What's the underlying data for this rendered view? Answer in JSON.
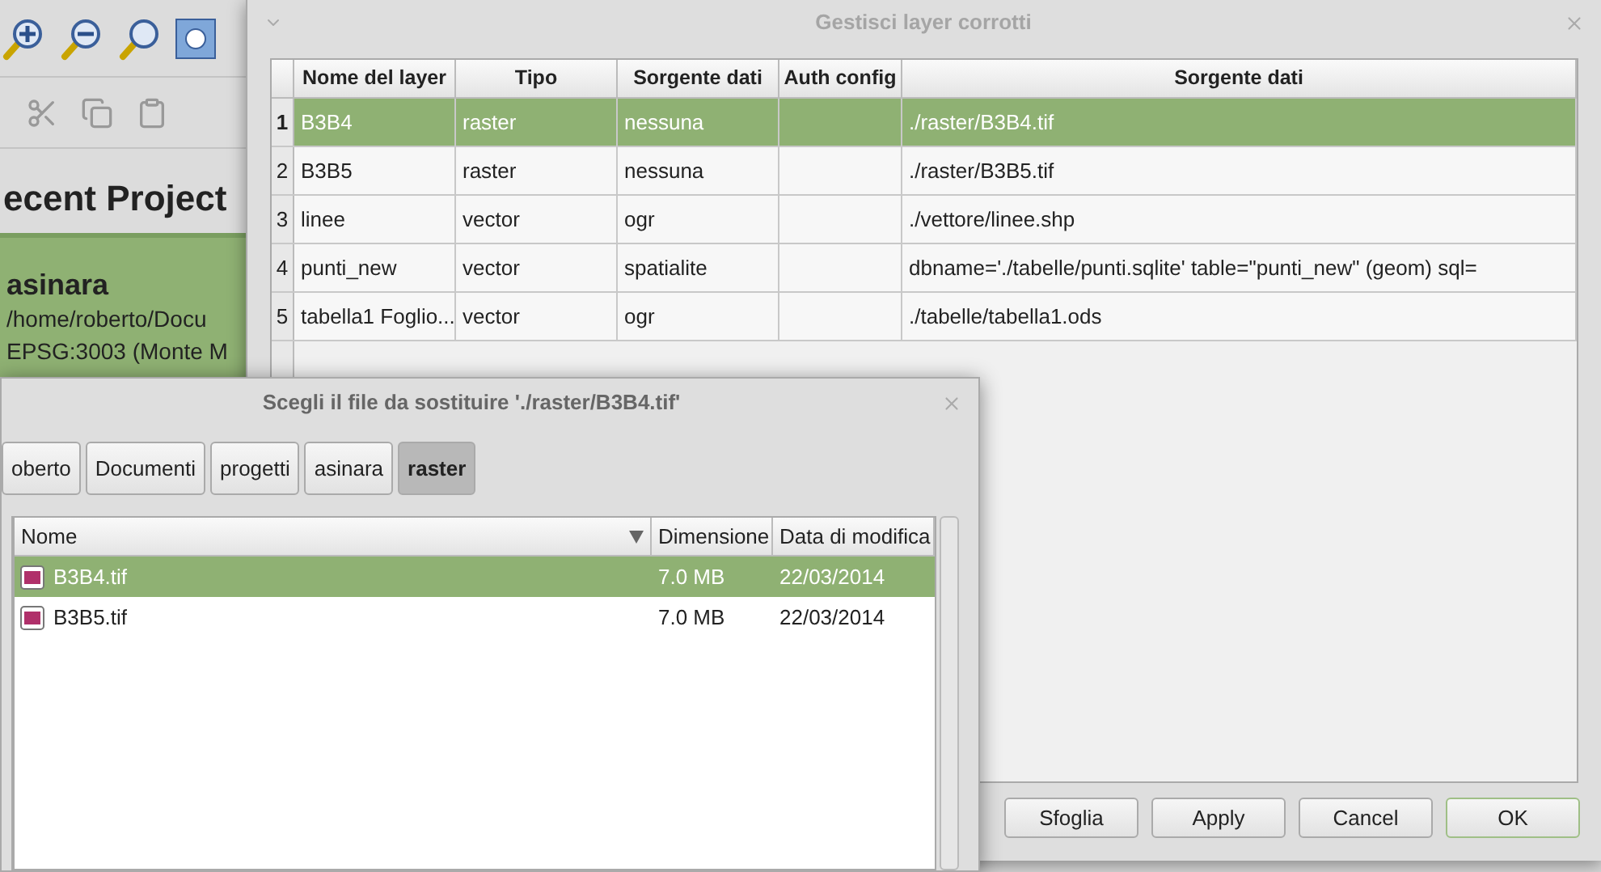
{
  "main_window": {
    "heading": "ecent Project",
    "recent_project": {
      "name": "asinara",
      "path": "/home/roberto/Docu",
      "crs": "EPSG:3003 (Monte M",
      "selected": true
    }
  },
  "layers_dialog": {
    "title": "Gestisci layer corrotti",
    "columns": [
      "Nome del layer",
      "Tipo",
      "Sorgente dati",
      "Auth config",
      "Sorgente dati"
    ],
    "rows": [
      {
        "number": "1",
        "cells": [
          "B3B4",
          "raster",
          "nessuna",
          "",
          "./raster/B3B4.tif"
        ],
        "selected": true
      },
      {
        "number": "2",
        "cells": [
          "B3B5",
          "raster",
          "nessuna",
          "",
          "./raster/B3B5.tif"
        ],
        "selected": false
      },
      {
        "number": "3",
        "cells": [
          "linee",
          "vector",
          "ogr",
          "",
          "./vettore/linee.shp"
        ],
        "selected": false
      },
      {
        "number": "4",
        "cells": [
          "punti_new",
          "vector",
          "spatialite",
          "",
          "dbname='./tabelle/punti.sqlite' table=\"punti_new\" (geom) sql="
        ],
        "selected": false
      },
      {
        "number": "5",
        "cells": [
          "tabella1 Foglio...",
          "vector",
          "ogr",
          "",
          "./tabelle/tabella1.ods"
        ],
        "selected": false
      }
    ],
    "buttons": [
      {
        "label": "Sfoglia",
        "default": false
      },
      {
        "label": "Apply",
        "default": false
      },
      {
        "label": "Cancel",
        "default": false
      },
      {
        "label": "OK",
        "default": true
      }
    ]
  },
  "file_dialog": {
    "title": "Scegli il file da sostituire './raster/B3B4.tif'",
    "breadcrumbs": [
      {
        "label": "oberto",
        "selected": false
      },
      {
        "label": "Documenti",
        "selected": false
      },
      {
        "label": "progetti",
        "selected": false
      },
      {
        "label": "asinara",
        "selected": false
      },
      {
        "label": "raster",
        "selected": true
      }
    ],
    "columns": [
      "Nome",
      "Dimensione",
      "Data di modifica"
    ],
    "files": [
      {
        "name": "B3B4.tif",
        "size": "7.0 MB",
        "date": "22/03/2014",
        "selected": true
      },
      {
        "name": "B3B5.tif",
        "size": "7.0 MB",
        "date": "22/03/2014",
        "selected": false
      }
    ]
  }
}
